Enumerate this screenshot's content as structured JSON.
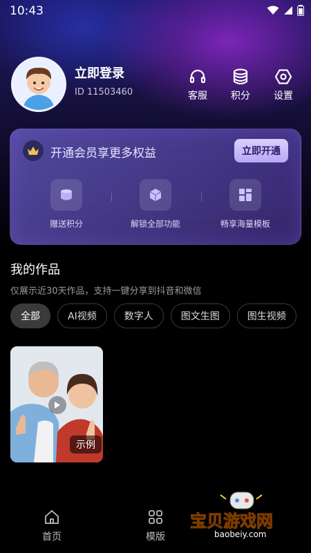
{
  "status_bar": {
    "time": "10:43"
  },
  "profile": {
    "login_label": "立即登录",
    "user_id": "ID 11503460",
    "quick_actions": [
      {
        "icon": "headset-icon",
        "label": "客服"
      },
      {
        "icon": "coins-icon",
        "label": "积分"
      },
      {
        "icon": "hex-gear-icon",
        "label": "设置"
      }
    ]
  },
  "vip": {
    "title": "开通会员享更多权益",
    "button_label": "立即开通",
    "benefits": [
      {
        "icon": "coin-stack-icon",
        "label": "赠送积分"
      },
      {
        "icon": "cube-icon",
        "label": "解锁全部功能"
      },
      {
        "icon": "templates-grid-icon",
        "label": "畅享海量模板"
      }
    ]
  },
  "works": {
    "title": "我的作品",
    "subtitle": "仅展示近30天作品，支持一键分享到抖音和微信",
    "filters": [
      "全部",
      "AI视频",
      "数字人",
      "图文生图",
      "图生视频"
    ],
    "active_filter": "全部",
    "sample_label": "示例"
  },
  "bottom_nav": [
    {
      "icon": "home-icon",
      "label": "首页"
    },
    {
      "icon": "grid-icon",
      "label": "模版"
    }
  ],
  "watermark": {
    "text": "宝贝游戏网",
    "url": "baobeiy.com"
  },
  "colors": {
    "accent": "#b7a9f5",
    "background": "#000000"
  }
}
